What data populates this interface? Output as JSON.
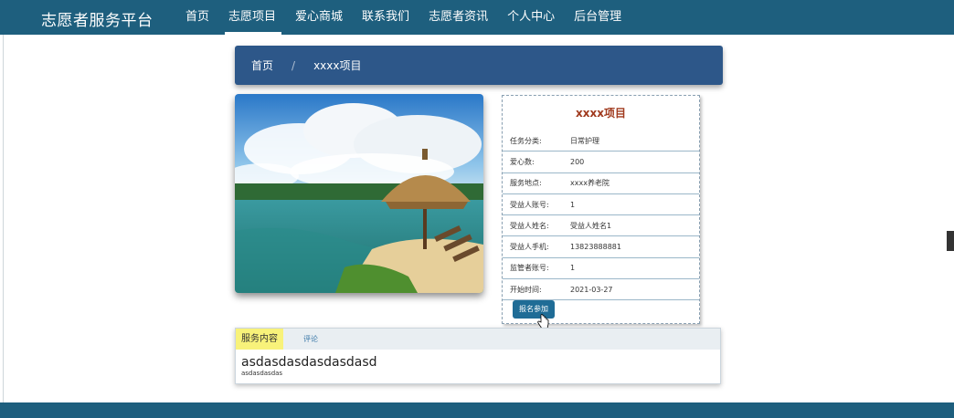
{
  "brand": "志愿者服务平台",
  "nav": {
    "items": [
      {
        "label": "首页"
      },
      {
        "label": "志愿项目"
      },
      {
        "label": "爱心商城"
      },
      {
        "label": "联系我们"
      },
      {
        "label": "志愿者资讯"
      },
      {
        "label": "个人中心"
      },
      {
        "label": "后台管理"
      }
    ],
    "active_index": 1
  },
  "breadcrumb": {
    "home": "首页",
    "separator": "/",
    "current": "xxxx项目"
  },
  "detail": {
    "title": "xxxx项目",
    "rows": [
      {
        "label": "任务分类:",
        "value": "日常护理"
      },
      {
        "label": "爱心数:",
        "value": "200"
      },
      {
        "label": "服务地点:",
        "value": "xxxx养老院"
      },
      {
        "label": "受益人账号:",
        "value": "1"
      },
      {
        "label": "受益人姓名:",
        "value": "受益人姓名1"
      },
      {
        "label": "受益人手机:",
        "value": "13823888881"
      },
      {
        "label": "监管者账号:",
        "value": "1"
      },
      {
        "label": "开始时间:",
        "value": "2021-03-27"
      }
    ],
    "join_button": "报名参加"
  },
  "tabs": {
    "content_tab": "服务内容",
    "comment_tab": "评论"
  },
  "content": {
    "heading": "asdasdasdasdasdasd",
    "text": "asdasdasdas"
  },
  "colors": {
    "header": "#1e5f7e",
    "breadcrumb": "#2d5789",
    "title": "#a03a1e",
    "button": "#1f6c96",
    "tab_active": "#f8f27a"
  }
}
